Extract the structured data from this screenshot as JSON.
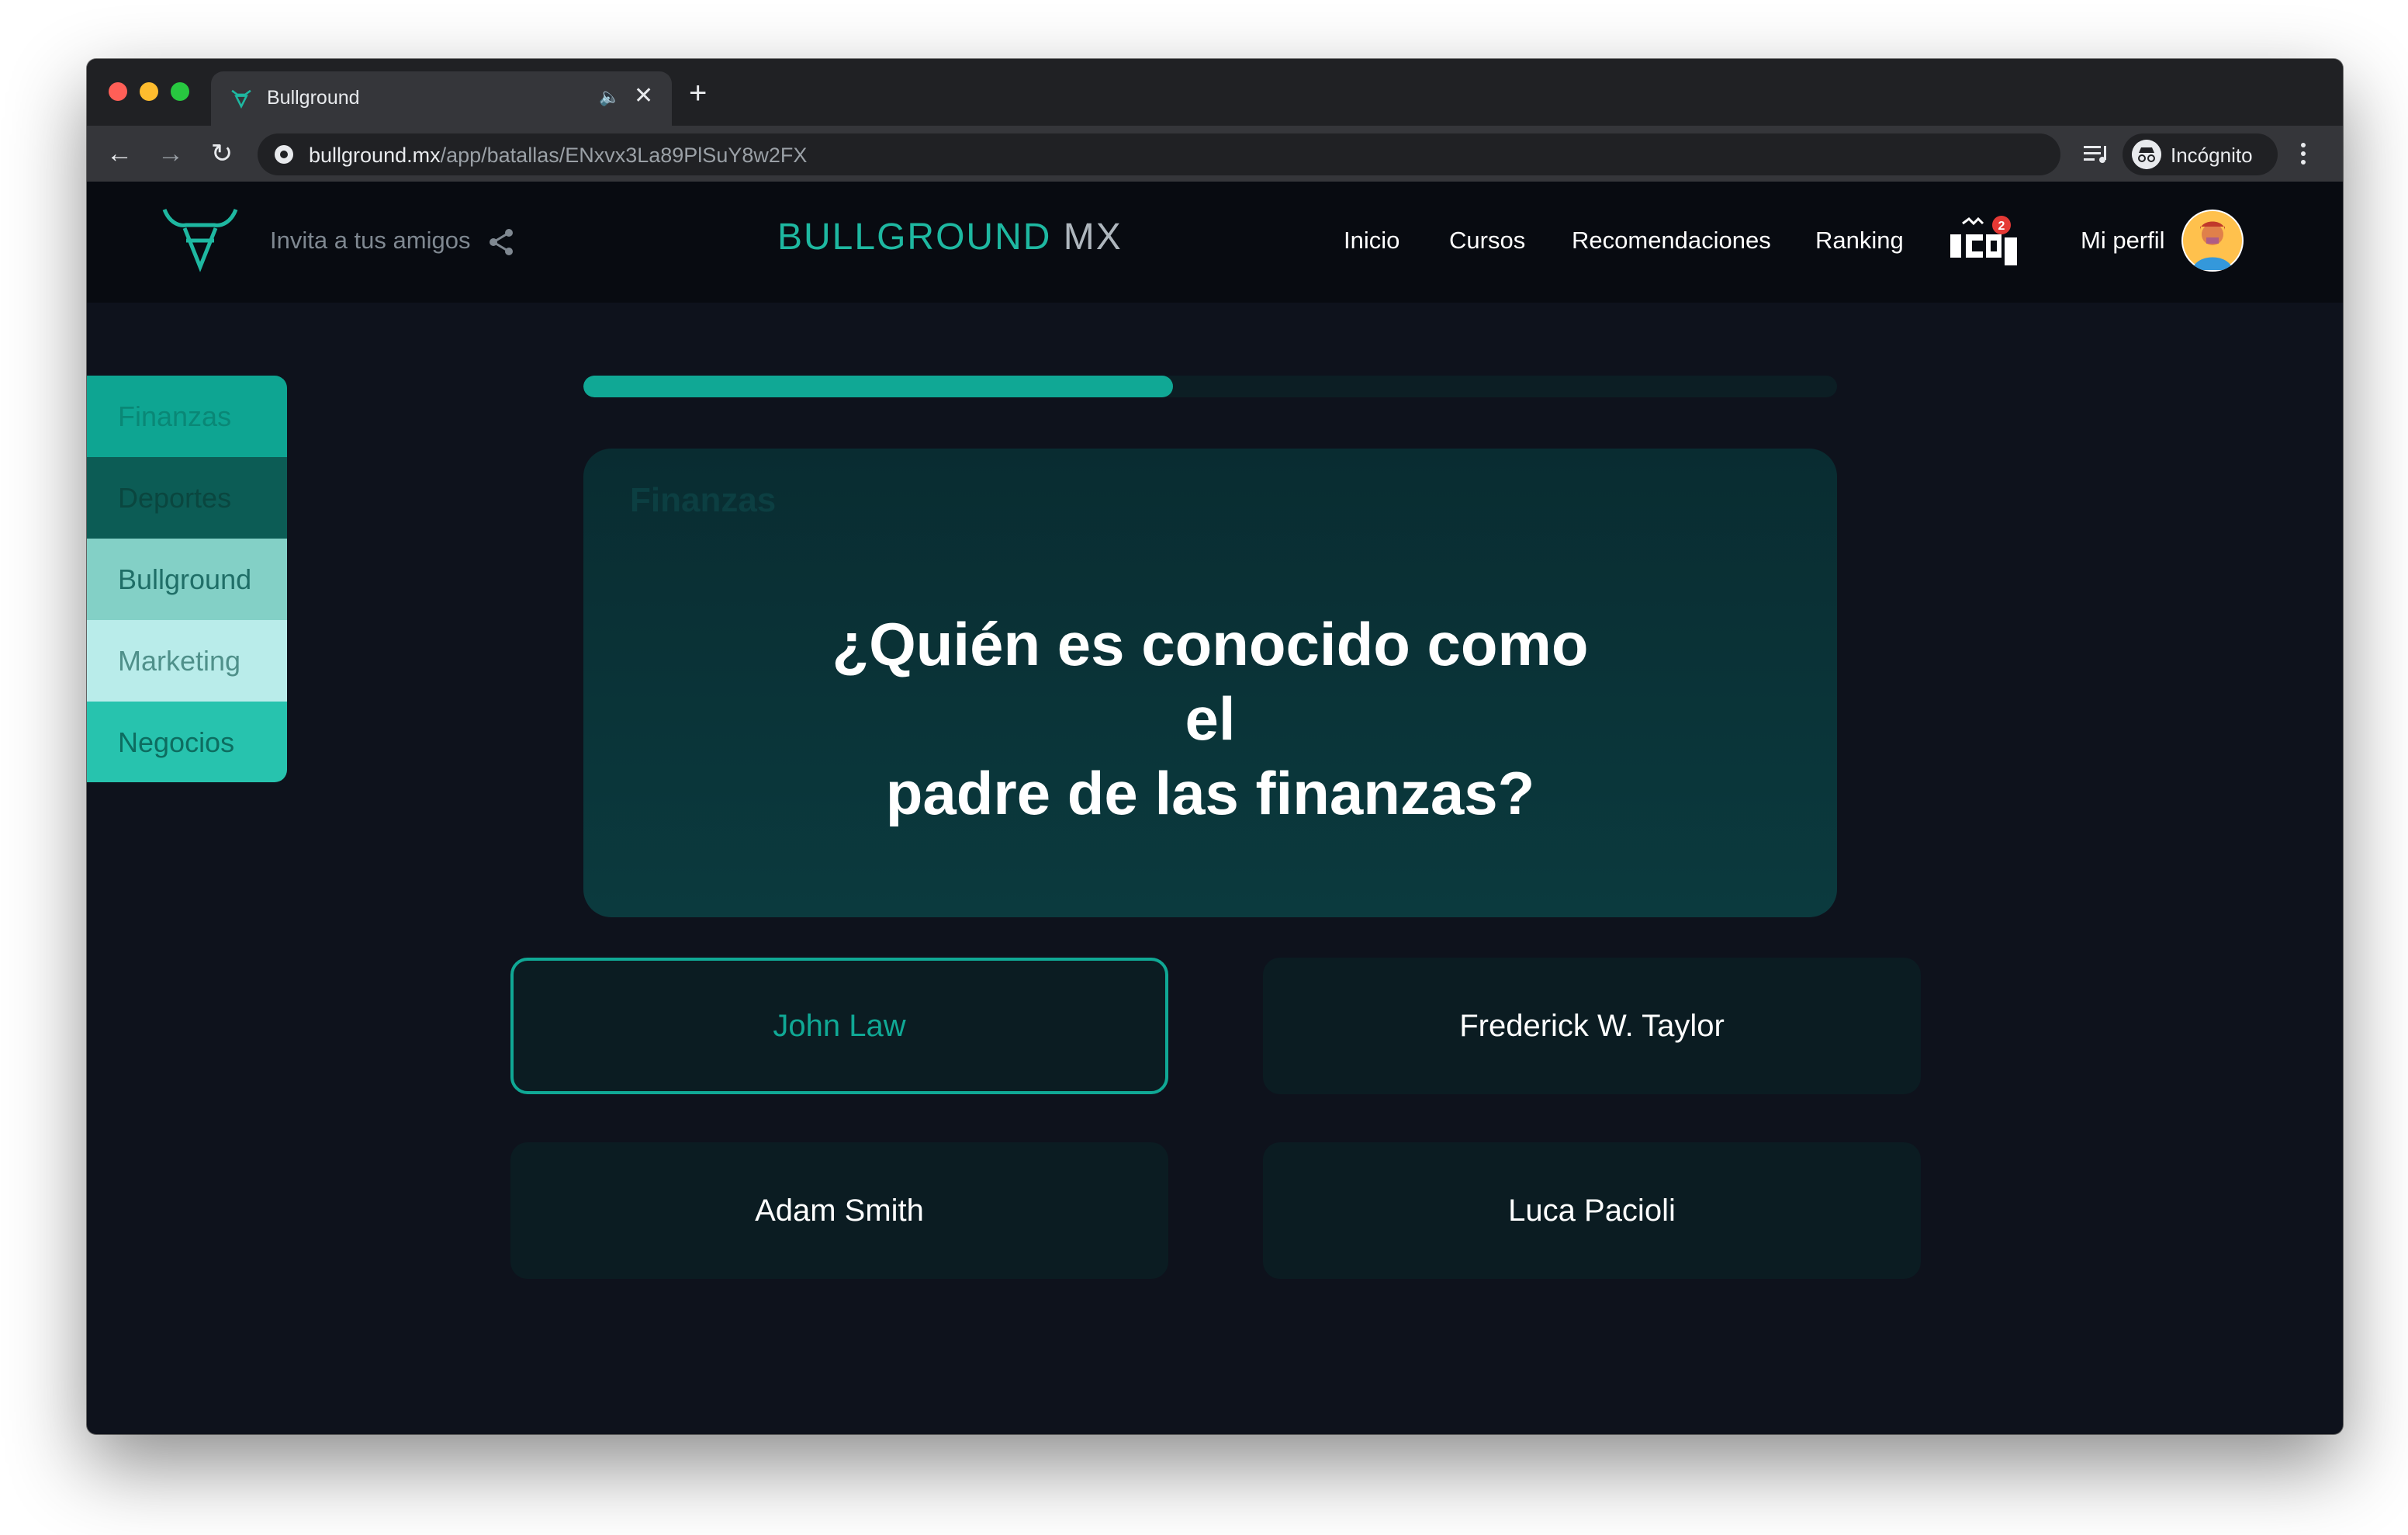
{
  "browser": {
    "tab_title": "Bullground",
    "new_tab_label": "+",
    "url_domain": "bullground.mx",
    "url_path": "/app/batallas/ENxvx3La89PlSuY8w2FX",
    "incognito_label": "Incógnito"
  },
  "header": {
    "invite_text": "Invita a tus amigos",
    "brand_primary": "BULLGROUND",
    "brand_secondary": "MX",
    "nav": {
      "inicio": "Inicio",
      "cursos": "Cursos",
      "recomendaciones": "Recomendaciones",
      "ranking": "Ranking",
      "perfil": "Mi perfil"
    },
    "notification_count": "2"
  },
  "sidebar": {
    "items": [
      {
        "label": "Finanzas"
      },
      {
        "label": "Deportes"
      },
      {
        "label": "Bullground"
      },
      {
        "label": "Marketing"
      },
      {
        "label": "Negocios"
      }
    ]
  },
  "quiz": {
    "progress_fraction": 0.47,
    "category": "Finanzas",
    "question_line1": "¿Quién es conocido como el",
    "question_line2": "padre de las finanzas?",
    "answers": [
      {
        "label": "John Law",
        "selected": true
      },
      {
        "label": "Frederick W. Taylor",
        "selected": false
      },
      {
        "label": "Adam Smith",
        "selected": false
      },
      {
        "label": "Luca Pacioli",
        "selected": false
      }
    ]
  },
  "colors": {
    "accent": "#10a895",
    "brand_teal": "#1eb8a1",
    "background": "#0e121c",
    "header_background": "#080b11",
    "card_background": "#0b3a3e",
    "answer_background": "#0b1c22"
  },
  "icons": {
    "logo": "bull-logo-icon",
    "share": "share-icon",
    "notifications": "notifications-icon",
    "avatar": "avatar-icon",
    "incognito": "incognito-icon",
    "media": "media-control-icon"
  }
}
